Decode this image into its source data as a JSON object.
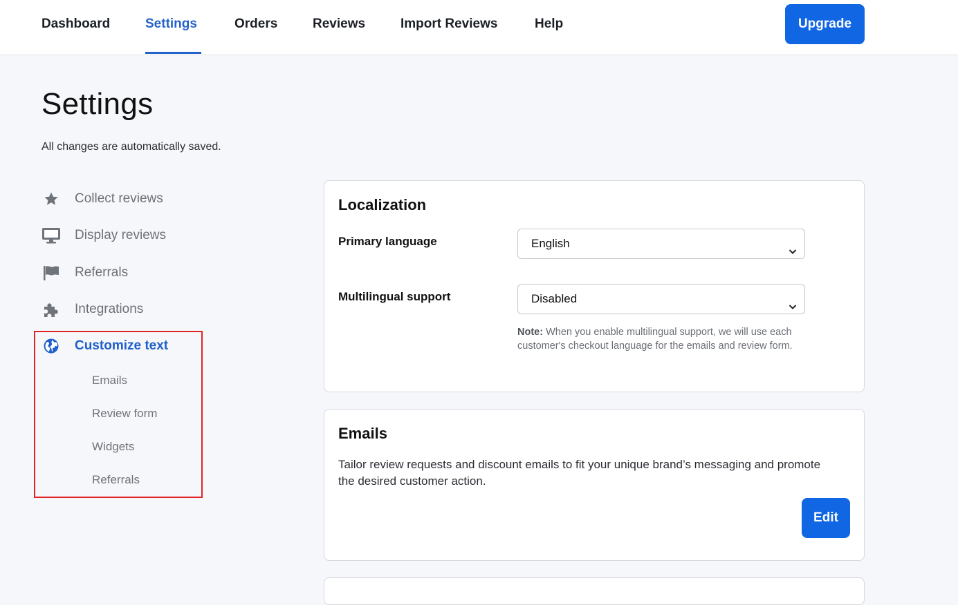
{
  "nav": {
    "items": [
      {
        "label": "Dashboard"
      },
      {
        "label": "Settings"
      },
      {
        "label": "Orders"
      },
      {
        "label": "Reviews"
      },
      {
        "label": "Import Reviews"
      },
      {
        "label": "Help"
      }
    ],
    "active": "Settings",
    "upgrade_label": "Upgrade"
  },
  "page": {
    "title": "Settings",
    "subtitle": "All changes are automatically saved."
  },
  "sidebar": {
    "items": [
      {
        "label": "Collect reviews",
        "icon": "star-icon"
      },
      {
        "label": "Display reviews",
        "icon": "monitor-icon"
      },
      {
        "label": "Referrals",
        "icon": "flag-icon"
      },
      {
        "label": "Integrations",
        "icon": "puzzle-icon"
      },
      {
        "label": "Customize text",
        "icon": "globe-icon"
      }
    ],
    "active": "Customize text",
    "subitems": [
      {
        "label": "Emails"
      },
      {
        "label": "Review form"
      },
      {
        "label": "Widgets"
      },
      {
        "label": "Referrals"
      }
    ]
  },
  "localization": {
    "title": "Localization",
    "primary_language_label": "Primary language",
    "primary_language_value": "English",
    "multilingual_label": "Multilingual support",
    "multilingual_value": "Disabled",
    "note_strong": "Note:",
    "note_text": " When you enable multilingual support, we will use each customer's checkout language for the emails and review form."
  },
  "emails": {
    "title": "Emails",
    "description": "Tailor review requests and discount emails to fit your unique brand’s messaging and promote the desired customer action.",
    "edit_label": "Edit"
  },
  "colors": {
    "accent": "#1166e3",
    "active_text": "#1f5fcc",
    "highlight": "#e02424"
  }
}
